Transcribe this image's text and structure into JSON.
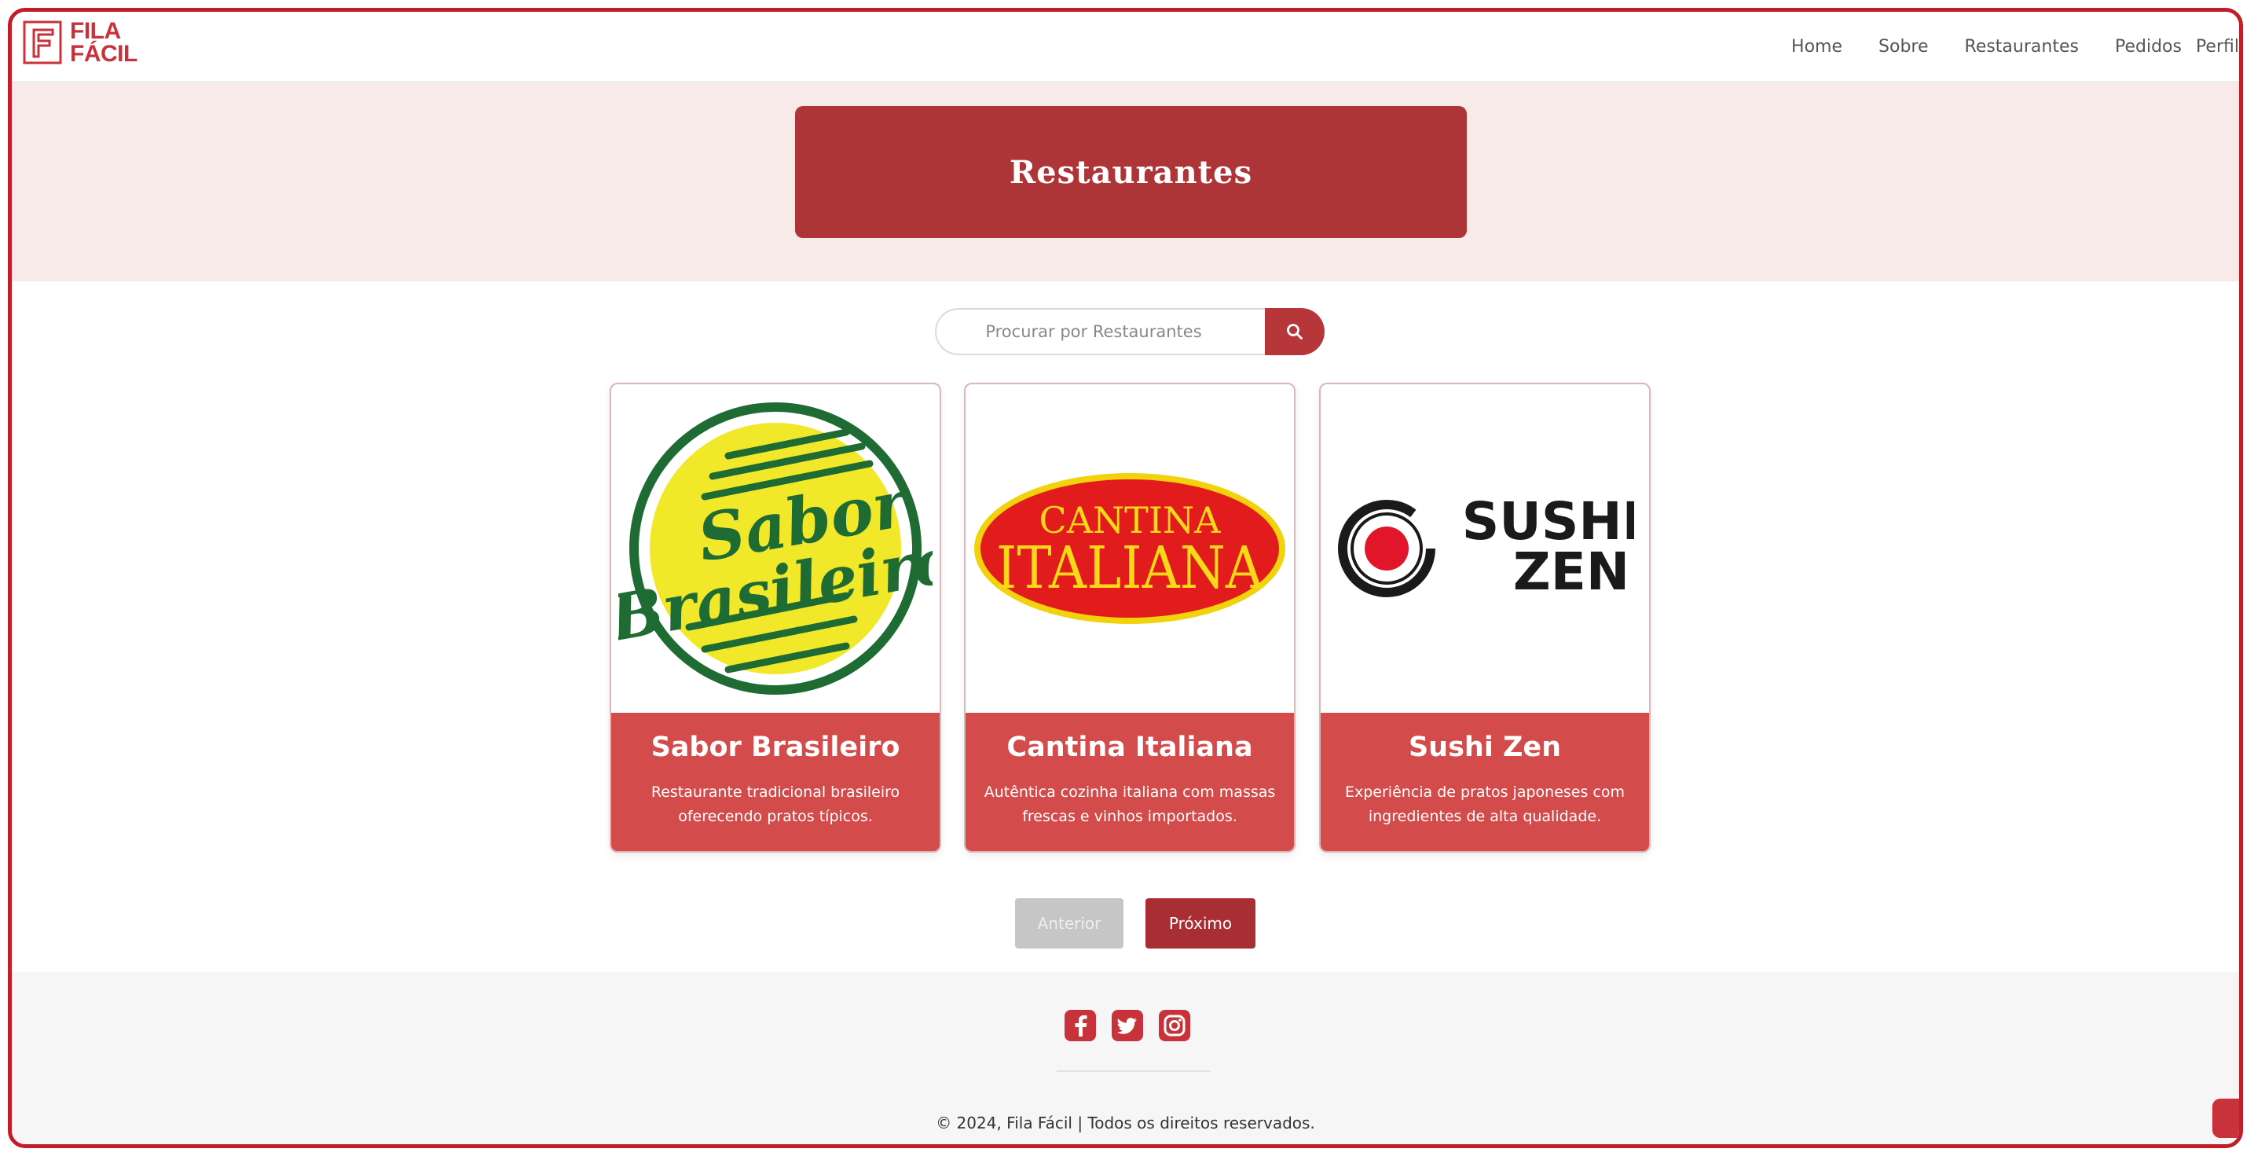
{
  "brand": {
    "line1": "FILA",
    "line2": "FÁCIL",
    "color": "#c8323a"
  },
  "nav": {
    "items": [
      "Home",
      "Sobre",
      "Restaurantes",
      "Pedidos",
      "Perfil"
    ]
  },
  "hero": {
    "title": "Restaurantes"
  },
  "search": {
    "placeholder": "Procurar por Restaurantes",
    "icon": "search-icon"
  },
  "restaurants": [
    {
      "name": "Sabor Brasileiro",
      "description": "Restaurante tradicional brasileiro oferecendo pratos típicos.",
      "logo_line1": "Sabor",
      "logo_line2": "Brasileiro"
    },
    {
      "name": "Cantina Italiana",
      "description": "Autêntica cozinha italiana com massas frescas e vinhos importados.",
      "logo_line1": "CANTINA",
      "logo_line2": "ITALIANA"
    },
    {
      "name": "Sushi Zen",
      "description": "Experiência de pratos japoneses com ingredientes de alta qualidade.",
      "logo_line1": "SUSHI",
      "logo_line2": "ZEN"
    }
  ],
  "pagination": {
    "prev": "Anterior",
    "next": "Próximo"
  },
  "footer": {
    "socials": [
      "facebook-icon",
      "twitter-icon",
      "instagram-icon"
    ],
    "copyright": "© 2024, Fila Fácil | Todos os direitos reservados."
  },
  "colors": {
    "accent": "#ad3538",
    "card": "#d44b4b",
    "hero_bg": "#f9eaea"
  }
}
